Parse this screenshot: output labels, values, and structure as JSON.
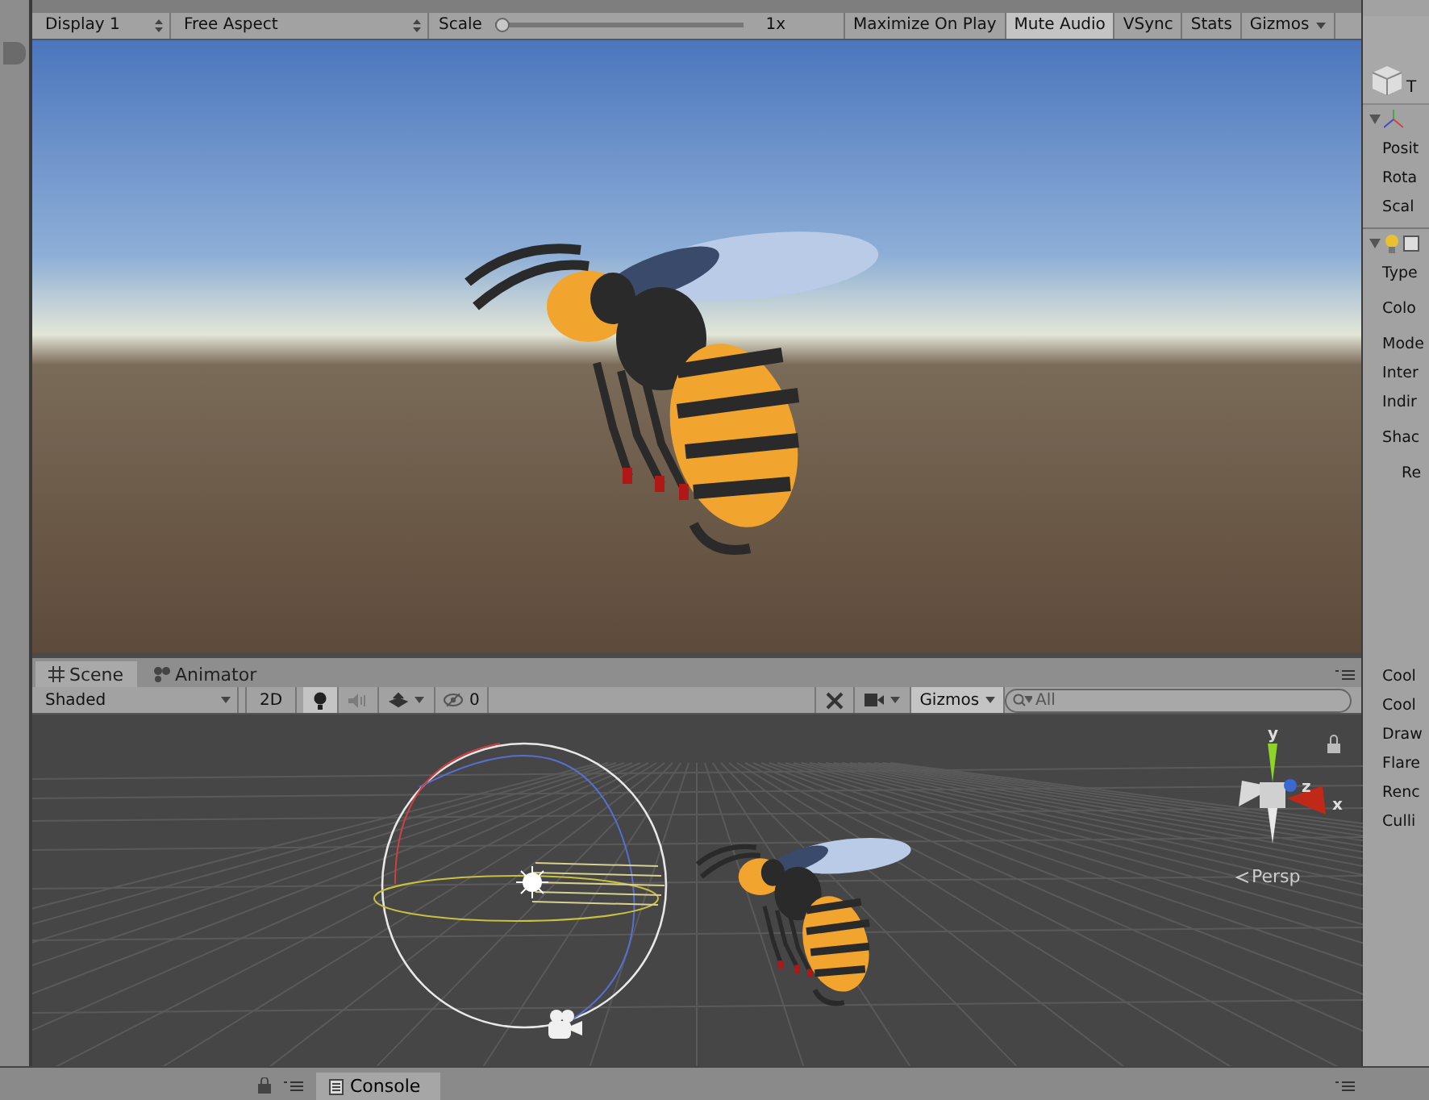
{
  "game_view": {
    "toolbar": {
      "display": "Display 1",
      "aspect": "Free Aspect",
      "scale_label": "Scale",
      "scale": {
        "level": 0.0
      },
      "scale_value": "1x",
      "buttons": [
        {
          "label": "Maximize On Play",
          "selected": false
        },
        {
          "label": "Mute Audio",
          "selected": true
        },
        {
          "label": "VSync",
          "selected": false
        },
        {
          "label": "Stats",
          "selected": false
        },
        {
          "label": "Gizmos",
          "selected": false,
          "kind": "dropdown"
        }
      ]
    }
  },
  "scene_view": {
    "tabs": [
      {
        "label": "Scene",
        "selected": true,
        "kind": "scene"
      },
      {
        "label": "Animator",
        "selected": false,
        "kind": "animator"
      }
    ],
    "toolbar": {
      "shading": "Shaded",
      "mode_2d": {
        "label": "2D",
        "selected": false
      },
      "lighting": true,
      "audio": false,
      "hidden_count": "0",
      "gizmos": "Gizmos",
      "search": {
        "placeholder": "All"
      }
    },
    "axis_labels": [
      "y",
      "z",
      "x"
    ],
    "projection": "Persp"
  },
  "inspector": {
    "header": "T",
    "rows": [
      {
        "label": "Posit",
        "kind": "row"
      },
      {
        "label": "Rota",
        "kind": "row"
      },
      {
        "label": "Scal",
        "kind": "row"
      },
      {
        "kind": "component"
      },
      {
        "label": "Type",
        "kind": "row"
      },
      {
        "label": "Colo",
        "kind": "tall"
      },
      {
        "label": "Mode",
        "kind": "row"
      },
      {
        "label": "Inter",
        "kind": "row"
      },
      {
        "label": "Indir",
        "kind": "row"
      },
      {
        "label": "Shac",
        "kind": "tall",
        "children": [
          {
            "label": "Re"
          }
        ]
      },
      {
        "kind": "spacer"
      },
      {
        "label": "Cool",
        "kind": "row"
      },
      {
        "label": "Cool",
        "kind": "row"
      },
      {
        "label": "Draw",
        "kind": "row"
      },
      {
        "label": "Flare",
        "kind": "row"
      },
      {
        "label": "Renc",
        "kind": "row"
      },
      {
        "label": "Culli",
        "kind": "row"
      }
    ]
  },
  "bottom_bar": {
    "tabs": [
      {
        "label": "Console",
        "selected": true
      }
    ]
  }
}
